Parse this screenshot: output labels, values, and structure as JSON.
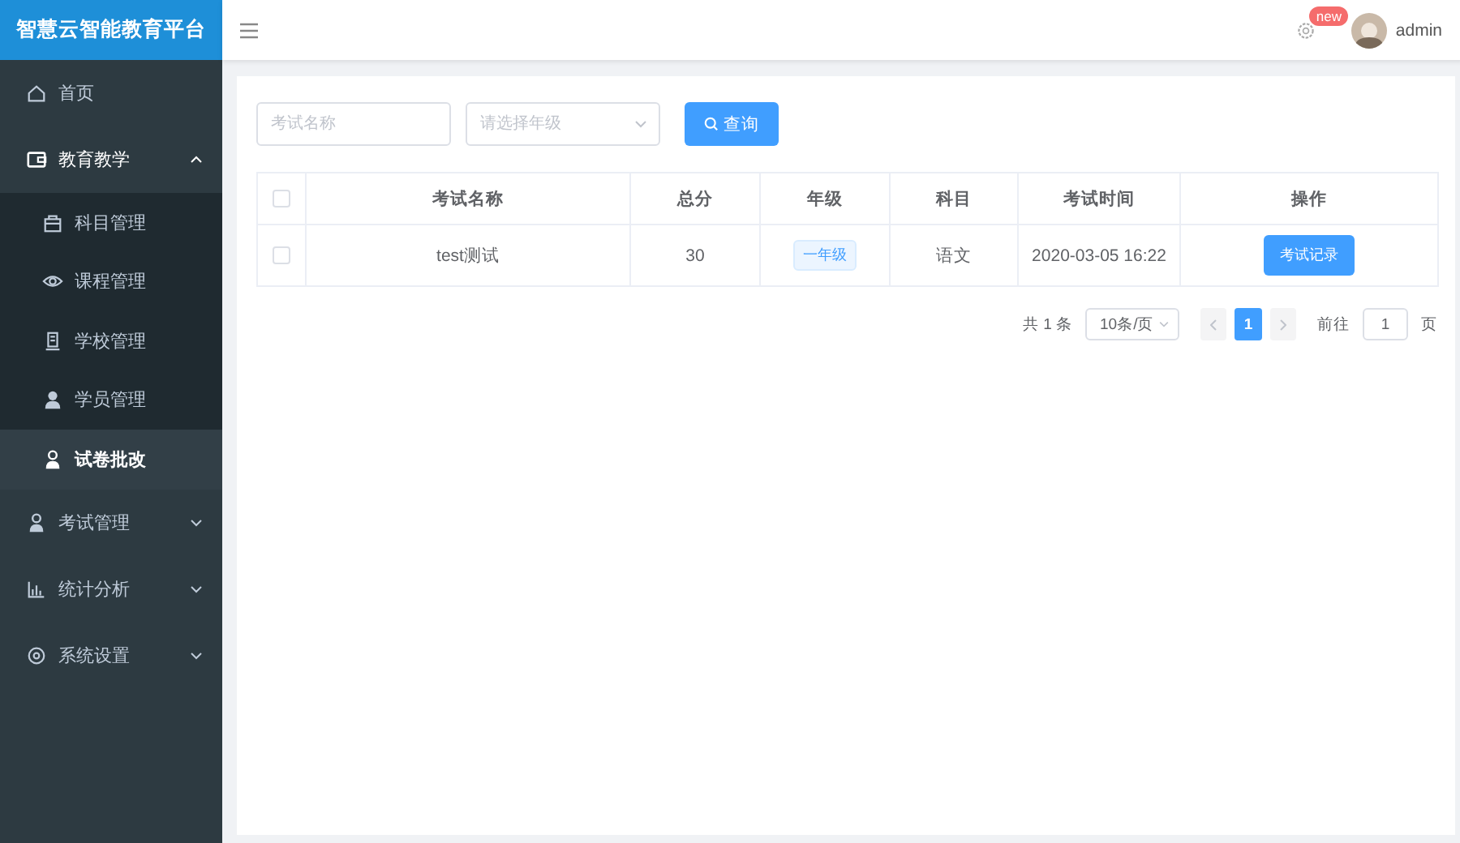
{
  "sidebar": {
    "logo": "智慧云智能教育平台",
    "items": [
      {
        "label": "首页",
        "kind": "link",
        "selected": false
      },
      {
        "label": "教育教学",
        "kind": "group",
        "expanded": true,
        "children": [
          {
            "label": "科目管理",
            "selected": false
          },
          {
            "label": "课程管理",
            "selected": false
          },
          {
            "label": "学校管理",
            "selected": false
          },
          {
            "label": "学员管理",
            "selected": false
          },
          {
            "label": "试卷批改",
            "selected": true
          }
        ]
      },
      {
        "label": "考试管理",
        "kind": "group",
        "expanded": false
      },
      {
        "label": "统计分析",
        "kind": "group",
        "expanded": false
      },
      {
        "label": "系统设置",
        "kind": "group",
        "expanded": false
      }
    ]
  },
  "header": {
    "badge": "new",
    "user": "admin"
  },
  "filters": {
    "name_placeholder": "考试名称",
    "grade_placeholder": "请选择年级",
    "query_button": "查询"
  },
  "table": {
    "header_checked": false,
    "columns": [
      "考试名称",
      "总分",
      "年级",
      "科目",
      "考试时间",
      "操作"
    ],
    "rows": [
      {
        "checked": false,
        "name": "test测试",
        "score": "30",
        "grade": "一年级",
        "subject": "语文",
        "time": "2020-03-05 16:22",
        "action": "考试记录"
      }
    ]
  },
  "pagination": {
    "total": "共 1 条",
    "page_size": "10条/页",
    "pages": [
      {
        "label": "1",
        "selected": true
      }
    ],
    "goto_label": "前往",
    "goto_value": "1",
    "page_suffix": "页"
  }
}
